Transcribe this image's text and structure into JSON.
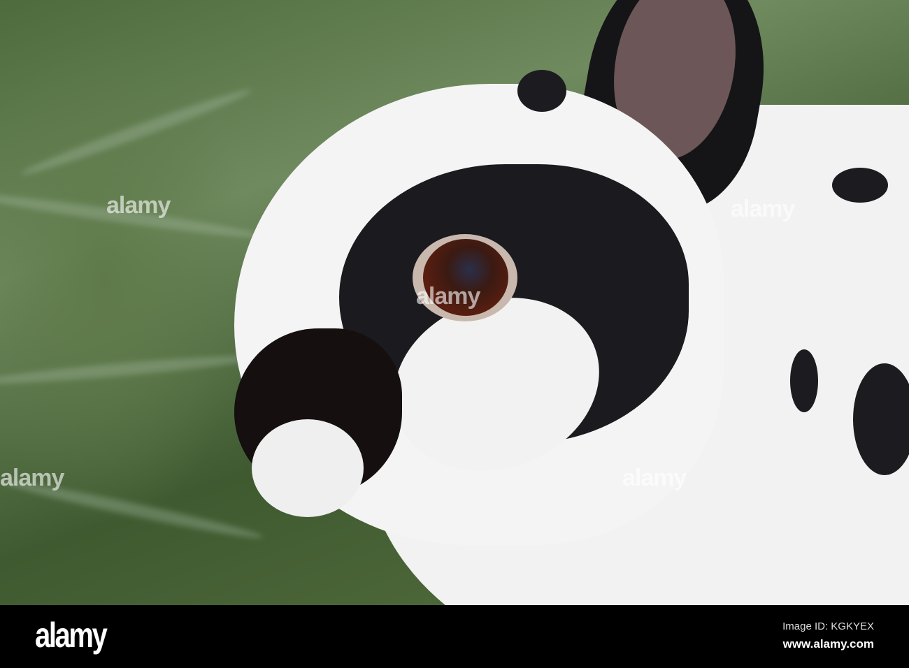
{
  "photo": {
    "subject": "black and white rabbit"
  },
  "watermark": {
    "text": "alamy"
  },
  "footer": {
    "logo": "alamy",
    "image_id": "Image ID: KGKYEX",
    "url": "www.alamy.com"
  }
}
